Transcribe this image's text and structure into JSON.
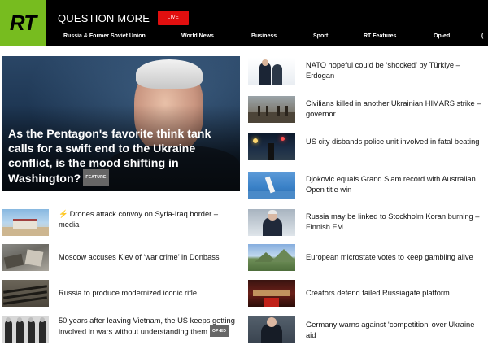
{
  "header": {
    "logo_text": "RT",
    "slogan": "QUESTION MORE",
    "live_label": "LIVE",
    "nav": [
      {
        "label": "Russia & Former Soviet Union"
      },
      {
        "label": "World News"
      },
      {
        "label": "Business"
      },
      {
        "label": "Sport"
      },
      {
        "label": "RT Features"
      },
      {
        "label": "Op-ed"
      },
      {
        "label": "("
      }
    ]
  },
  "colors": {
    "brand_green": "#77bc1f",
    "live_red": "#e10f0f",
    "header_bg": "#000000"
  },
  "hero": {
    "title": "As the Pentagon's favorite think tank calls for a swift end to the Ukraine conflict, is the mood shifting in Washington?",
    "badge": "FEATURE"
  },
  "left_stories": [
    {
      "title": "Drones attack convoy on Syria-Iraq border – media",
      "icon": "lightning-bolt-icon"
    },
    {
      "title": "Moscow accuses Kiev of ‘war crime’ in Donbass"
    },
    {
      "title": "Russia to produce modernized iconic rifle"
    },
    {
      "title": "50 years after leaving Vietnam, the US keeps getting involved in wars without understanding them",
      "badge": "OP-ED"
    }
  ],
  "right_stories": [
    {
      "title": "NATO hopeful could be ‘shocked’ by Türkiye – Erdogan"
    },
    {
      "title": "Civilians killed in another Ukrainian HIMARS strike – governor"
    },
    {
      "title": "US city disbands police unit involved in fatal beating"
    },
    {
      "title": "Djokovic equals Grand Slam record with Australian Open title win"
    },
    {
      "title": "Russia may be linked to Stockholm Koran burning – Finnish FM"
    },
    {
      "title": "European microstate votes to keep gambling alive"
    },
    {
      "title": "Creators defend failed Russiagate platform"
    },
    {
      "title": "Germany warns against ‘competition’ over Ukraine aid"
    }
  ]
}
